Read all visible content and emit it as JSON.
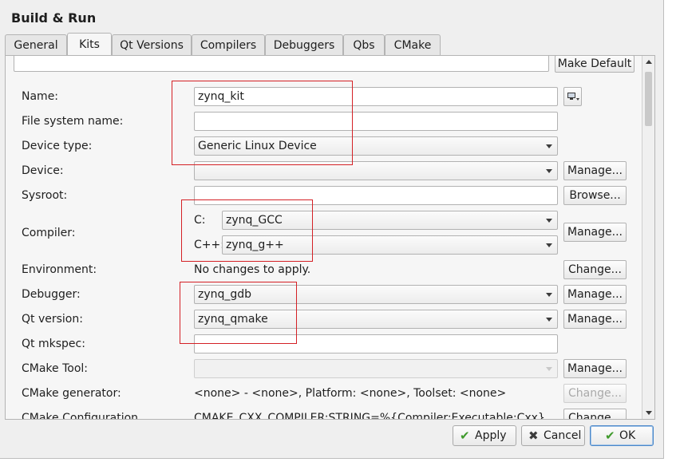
{
  "window": {
    "title": "Build & Run"
  },
  "tabs": [
    {
      "label": "General"
    },
    {
      "label": "Kits"
    },
    {
      "label": "Qt Versions"
    },
    {
      "label": "Compilers"
    },
    {
      "label": "Debuggers"
    },
    {
      "label": "Qbs"
    },
    {
      "label": "CMake"
    }
  ],
  "active_tab": "Kits",
  "top": {
    "make_default_label": "Make Default"
  },
  "form": {
    "name": {
      "label": "Name:",
      "value": "zynq_kit"
    },
    "file_system_name": {
      "label": "File system name:",
      "value": ""
    },
    "device_type": {
      "label": "Device type:",
      "value": "Generic Linux Device"
    },
    "device": {
      "label": "Device:",
      "value": "",
      "button": "Manage..."
    },
    "sysroot": {
      "label": "Sysroot:",
      "value": "",
      "button": "Browse..."
    },
    "compiler": {
      "label": "Compiler:",
      "c_label": "C:",
      "c_value": "zynq_GCC",
      "cpp_label": "C++:",
      "cpp_value": "zynq_g++",
      "button": "Manage..."
    },
    "environment": {
      "label": "Environment:",
      "value": "No changes to apply.",
      "button": "Change..."
    },
    "debugger": {
      "label": "Debugger:",
      "value": "zynq_gdb",
      "button": "Manage..."
    },
    "qt_version": {
      "label": "Qt version:",
      "value": "zynq_qmake",
      "button": "Manage..."
    },
    "qt_mkspec": {
      "label": "Qt mkspec:",
      "value": ""
    },
    "cmake_tool": {
      "label": "CMake Tool:",
      "value": "",
      "button": "Manage..."
    },
    "cmake_generator": {
      "label": "CMake generator:",
      "value": "<none> - <none>, Platform: <none>, Toolset: <none>",
      "button": "Change..."
    },
    "cmake_configuration": {
      "label": "CMake Configuration",
      "value": "CMAKE_CXX_COMPILER:STRING=%{Compiler:Executable:Cxx}; C",
      "button": "Change..."
    }
  },
  "buttons": {
    "apply": "Apply",
    "cancel": "Cancel",
    "ok": "OK"
  },
  "icons": {
    "device": "monitor-icon",
    "apply": "checkmark-icon",
    "cancel": "x-mark-icon",
    "ok": "checkmark-icon"
  },
  "colors": {
    "annotation": "#d42025",
    "default_button_border": "#4b87c8"
  }
}
